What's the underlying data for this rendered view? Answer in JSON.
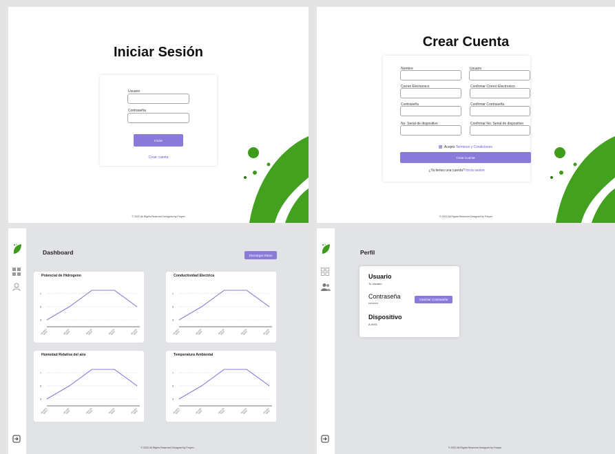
{
  "login": {
    "title": "Iniciar Sesión",
    "user_label": "Usuario",
    "pass_label": "Contraseña",
    "submit_label": "Iniciar",
    "create_link": "Crear cuenta",
    "footer": "© 2022 All Rights Reserved Designed by Freyen"
  },
  "signup": {
    "title": "Crear Cuenta",
    "fields": [
      {
        "label": "Nombre"
      },
      {
        "label": "Usuario"
      },
      {
        "label": "Correo Electronico"
      },
      {
        "label": "Confirmar Correo Electronico"
      },
      {
        "label": "Contraseña"
      },
      {
        "label": "Confirmar Contraseña"
      },
      {
        "label": "No. Serial de dispositivo"
      },
      {
        "label": "Confirmar No. Serial de dispositivo"
      }
    ],
    "accept_prefix": "Acepto",
    "accept_link": "Terminos y Condiciones",
    "submit_label": "Crear Cuenta",
    "have_account": "¿Ya tienes una cuenta?",
    "login_link": "Inicia sesion",
    "footer": "© 2022 All Rights Reserved Designed by Freyen"
  },
  "dashboard": {
    "title": "Dashboard",
    "download_label": "Descargar Datos",
    "footer": "© 2022 All Rights Reserved Designed by Freyen"
  },
  "profile": {
    "title": "Perfil",
    "user_heading": "Usuario",
    "user_value": "Tu Usuario",
    "pass_heading": "Contraseña",
    "pass_value": "••••••••••",
    "change_pass_label": "Cambiar Contraseña",
    "device_heading": "Dispositivo",
    "device_value": "A-0001",
    "footer": "© 2022 All Rights Reserved Designed by Freyen"
  },
  "colors": {
    "accent": "#8a7bdb",
    "leaf_green": "#3f9b1c",
    "leaf_dark": "#2c7a10"
  },
  "chart_data": [
    {
      "type": "line",
      "title": "Potencial de Hidrogeno",
      "x": [
        "05/09/22",
        "05/10/22",
        "05/11/22",
        "05/12/22",
        "05/13/22"
      ],
      "x_lines": [
        "00/00",
        "00/00",
        "00/00",
        "00/00",
        "00/00"
      ],
      "values": [
        3,
        5,
        7.5,
        7.5,
        5
      ],
      "yticks": [
        "7",
        "5",
        "3"
      ],
      "series_color": "#8a7bdb"
    },
    {
      "type": "line",
      "title": "Conductividad Electrica",
      "x": [
        "05/09/22",
        "05/10/22",
        "05/11/22",
        "05/12/22",
        "05/13/22"
      ],
      "x_lines": [
        "00/00",
        "00/00",
        "00/00",
        "00/00",
        "00/00"
      ],
      "values": [
        3,
        5,
        7.5,
        7.5,
        5
      ],
      "yticks": [
        "7",
        "5",
        "3"
      ],
      "series_color": "#8a7bdb"
    },
    {
      "type": "line",
      "title": "Humedad Relativa del aire",
      "x": [
        "05/09/22",
        "05/10/22",
        "05/11/22",
        "05/12/22",
        "05/13/22"
      ],
      "x_lines": [
        "00/00",
        "00/00",
        "00/00",
        "00/00",
        "00/00"
      ],
      "values": [
        3,
        5,
        7.5,
        7.5,
        5
      ],
      "yticks": [
        "7",
        "5",
        "3"
      ],
      "series_color": "#8a7bdb"
    },
    {
      "type": "line",
      "title": "Temperatura Ambiental",
      "x": [
        "05/09/22",
        "05/10/22",
        "05/11/22",
        "05/12/22",
        "05/13/22"
      ],
      "x_lines": [
        "00/00",
        "00/00",
        "00/00",
        "00/00",
        "00/00"
      ],
      "values": [
        3,
        5,
        7.5,
        7.5,
        5
      ],
      "yticks": [
        "7",
        "5",
        "3"
      ],
      "series_color": "#8a7bdb"
    }
  ]
}
